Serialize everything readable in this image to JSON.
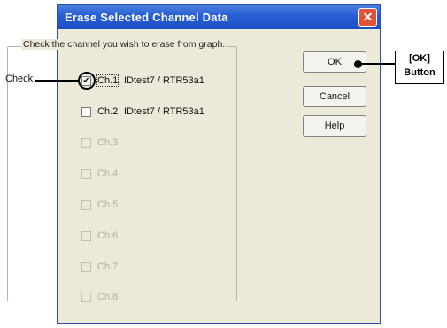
{
  "dialog": {
    "title": "Erase Selected Channel Data",
    "close_icon": "close-icon",
    "group_label": "Check the channel you wish to erase from graph.",
    "channels": [
      {
        "label": "Ch.1",
        "desc": "IDtest7  / RTR53a1",
        "checked": true,
        "enabled": true
      },
      {
        "label": "Ch.2",
        "desc": "IDtest7  / RTR53a1",
        "checked": false,
        "enabled": true
      },
      {
        "label": "Ch.3",
        "desc": "",
        "checked": false,
        "enabled": false
      },
      {
        "label": "Ch.4",
        "desc": "",
        "checked": false,
        "enabled": false
      },
      {
        "label": "Ch.5",
        "desc": "",
        "checked": false,
        "enabled": false
      },
      {
        "label": "Ch.6",
        "desc": "",
        "checked": false,
        "enabled": false
      },
      {
        "label": "Ch.7",
        "desc": "",
        "checked": false,
        "enabled": false
      },
      {
        "label": "Ch.8",
        "desc": "",
        "checked": false,
        "enabled": false
      }
    ],
    "buttons": {
      "ok": "OK",
      "cancel": "Cancel",
      "help": "Help"
    }
  },
  "annotations": {
    "check_label": "Check",
    "ok_callout_line1": "[OK]",
    "ok_callout_line2": "Button"
  },
  "colors": {
    "title_bar": "#2a60d4",
    "close_button": "#e0523a",
    "dialog_bg": "#ece9d8"
  }
}
